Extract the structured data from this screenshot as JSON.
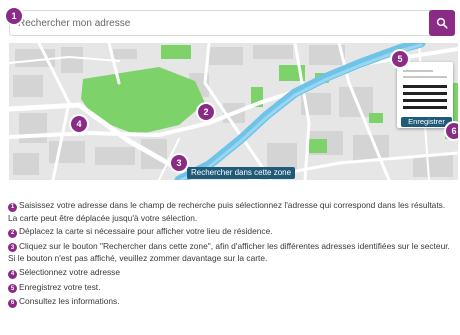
{
  "search": {
    "placeholder": "Rechercher mon adresse",
    "button_icon": "search-icon"
  },
  "badges": [
    "1",
    "2",
    "3",
    "4",
    "5",
    "6"
  ],
  "map": {
    "search_zone_button": "Rechercher dans cette zone",
    "save_button": "Enregistrer"
  },
  "colors": {
    "accent": "#8a2c86",
    "button": "#1f5b78",
    "park": "#7dd36a",
    "water": "#6fc3e8"
  },
  "instructions": [
    {
      "num": "1",
      "text": "Saisissez votre adresse dans le champ de recherche puis sélectionnez l'adresse qui correspond dans les résultats. La carte peut être déplacée jusqu'à votre sélection."
    },
    {
      "num": "2",
      "text": "Déplacez la carte si nécessaire pour afficher votre lieu de résidence."
    },
    {
      "num": "3",
      "text": "Cliquez sur le bouton \"Rechercher dans cette zone\", afin d'afficher les différentes adresses identifiées sur le secteur. Si le bouton n'est pas affiché, veuillez zommer davantage sur la carte."
    },
    {
      "num": "4",
      "text": "Sélectionnez votre adresse"
    },
    {
      "num": "5",
      "text": "Enregistrez votre test."
    },
    {
      "num": "6",
      "text": "Consultez les informations."
    }
  ]
}
